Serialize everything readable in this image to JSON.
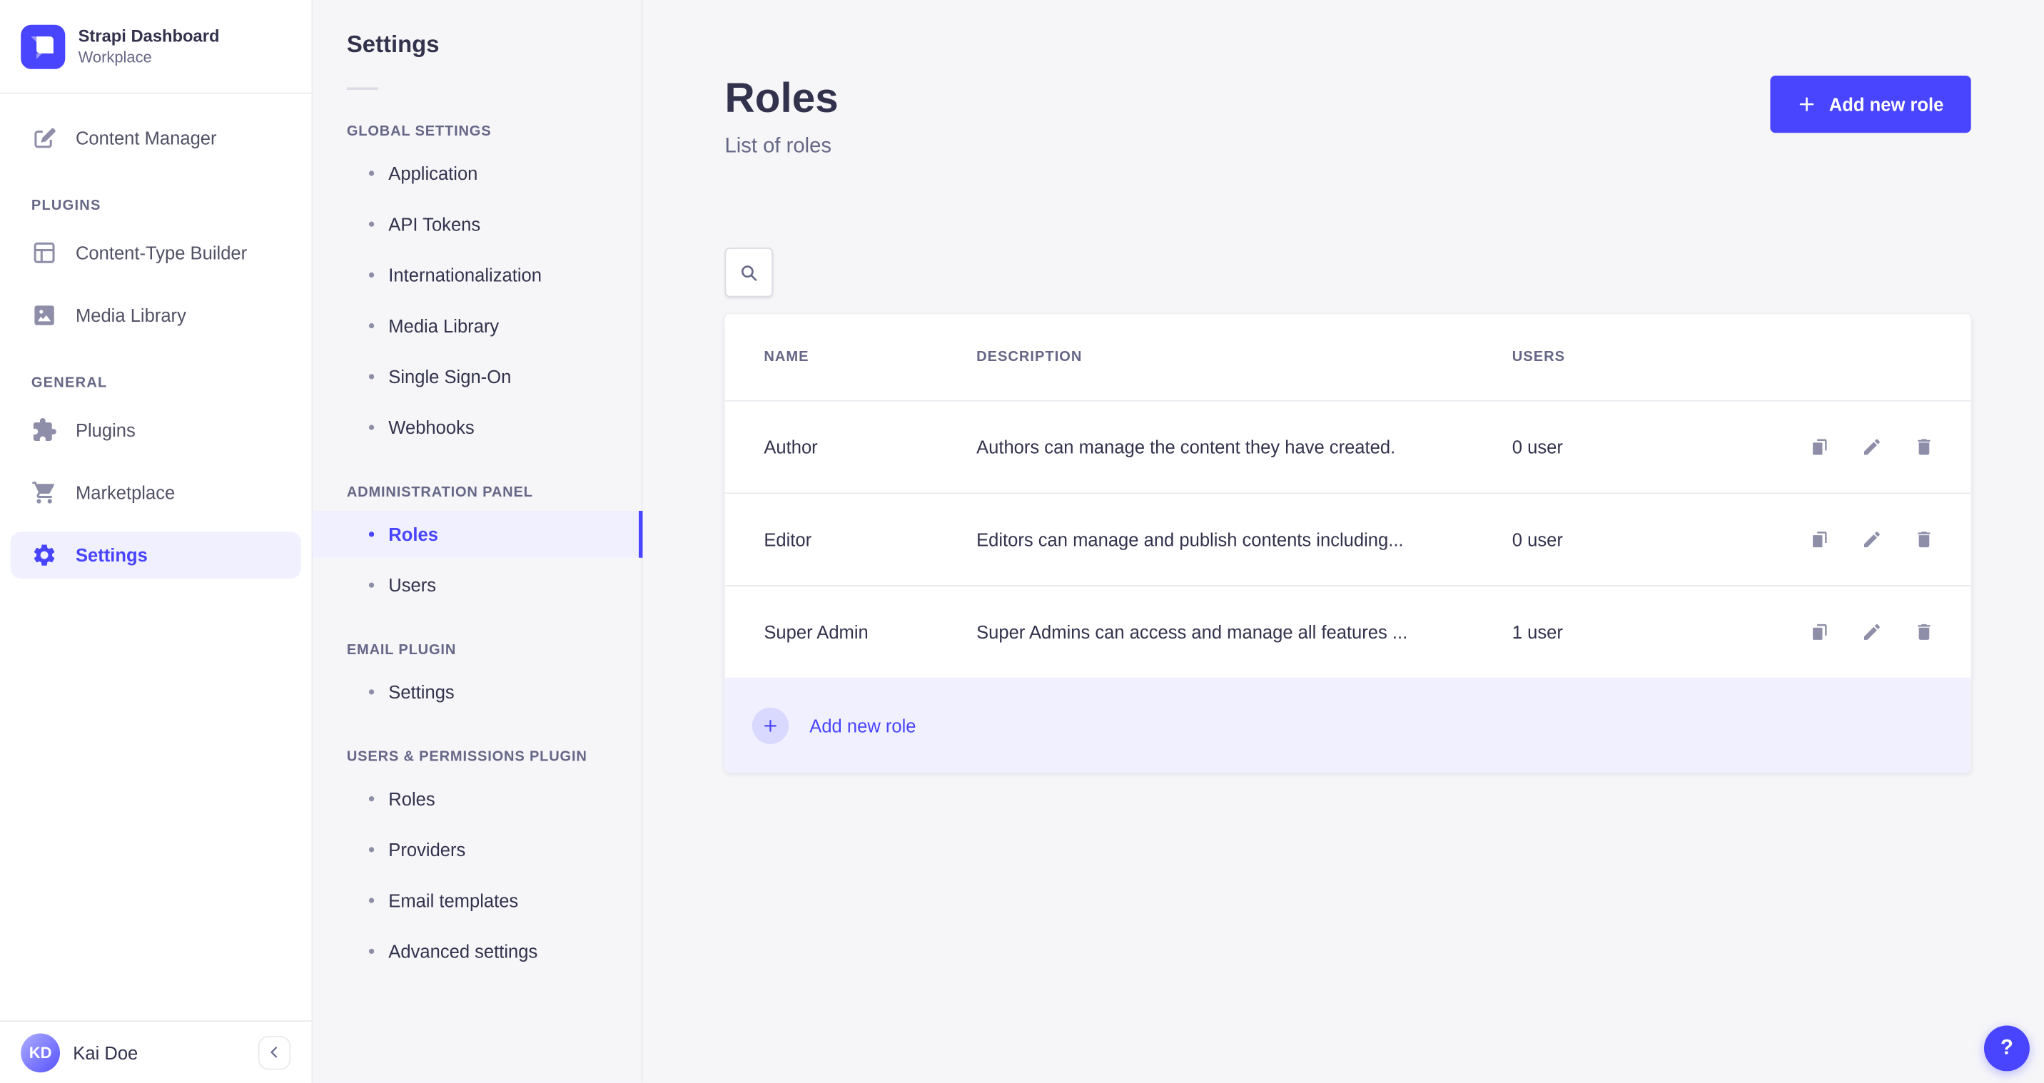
{
  "app": {
    "title": "Strapi Dashboard",
    "workspace": "Workplace",
    "logo_icon": "strapi-logo-icon"
  },
  "colors": {
    "accent": "#4945ff",
    "accent_soft": "#f0f0ff",
    "page_bg": "#f6f6f9",
    "border": "#eaeaef",
    "text": "#32324d",
    "text_muted": "#666687",
    "icon_muted": "#8e8ea9",
    "footer_plus_bg": "#d9d8ff"
  },
  "sidebar": {
    "collapse_icon": "chevron-left-icon",
    "sections": [
      {
        "label": "",
        "items": [
          {
            "label": "Content Manager",
            "icon": "pen-icon"
          }
        ]
      },
      {
        "label": "PLUGINS",
        "items": [
          {
            "label": "Content-Type Builder",
            "icon": "layout-icon"
          },
          {
            "label": "Media Library",
            "icon": "image-icon"
          }
        ]
      },
      {
        "label": "GENERAL",
        "items": [
          {
            "label": "Plugins",
            "icon": "puzzle-icon"
          },
          {
            "label": "Marketplace",
            "icon": "cart-icon"
          },
          {
            "label": "Settings",
            "icon": "gear-icon",
            "active": true
          }
        ]
      }
    ],
    "user": {
      "initials": "KD",
      "name": "Kai Doe"
    }
  },
  "subnav": {
    "title": "Settings",
    "sections": [
      {
        "label": "GLOBAL SETTINGS",
        "items": [
          {
            "label": "Application"
          },
          {
            "label": "API Tokens"
          },
          {
            "label": "Internationalization"
          },
          {
            "label": "Media Library"
          },
          {
            "label": "Single Sign-On"
          },
          {
            "label": "Webhooks"
          }
        ]
      },
      {
        "label": "ADMINISTRATION PANEL",
        "items": [
          {
            "label": "Roles",
            "active": true
          },
          {
            "label": "Users"
          }
        ]
      },
      {
        "label": "EMAIL PLUGIN",
        "items": [
          {
            "label": "Settings"
          }
        ]
      },
      {
        "label": "USERS & PERMISSIONS PLUGIN",
        "items": [
          {
            "label": "Roles"
          },
          {
            "label": "Providers"
          },
          {
            "label": "Email templates"
          },
          {
            "label": "Advanced settings"
          }
        ]
      }
    ]
  },
  "main": {
    "title": "Roles",
    "subtitle": "List of roles",
    "add_button_label": "Add new role",
    "add_button_icon": "plus-icon",
    "search_icon": "search-icon",
    "table": {
      "headers": [
        "NAME",
        "DESCRIPTION",
        "USERS"
      ],
      "rows": [
        {
          "name": "Author",
          "description": "Authors can manage the content they have created.",
          "users": "0 user"
        },
        {
          "name": "Editor",
          "description": "Editors can manage and publish contents including...",
          "users": "0 user"
        },
        {
          "name": "Super Admin",
          "description": "Super Admins can access and manage all features ...",
          "users": "1 user"
        }
      ],
      "row_actions": [
        "duplicate-icon",
        "edit-icon",
        "delete-icon"
      ],
      "footer_label": "Add new role",
      "footer_icon": "plus-icon"
    },
    "help_label": "?"
  }
}
